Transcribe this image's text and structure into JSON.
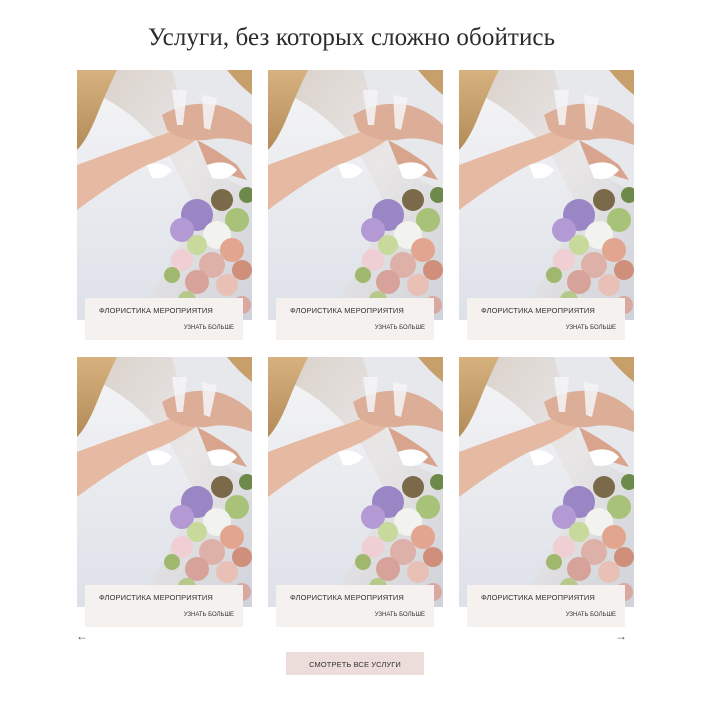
{
  "section": {
    "title": "Услуги, без которых сложно обойтись"
  },
  "cards": [
    {
      "title": "ФЛОРИСТИКА МЕРОПРИЯТИЯ",
      "more": "УЗНАТЬ БОЛЬШЕ"
    },
    {
      "title": "ФЛОРИСТИКА МЕРОПРИЯТИЯ",
      "more": "УЗНАТЬ БОЛЬШЕ"
    },
    {
      "title": "ФЛОРИСТИКА МЕРОПРИЯТИЯ",
      "more": "УЗНАТЬ БОЛЬШЕ"
    },
    {
      "title": "ФЛОРИСТИКА МЕРОПРИЯТИЯ",
      "more": "УЗНАТЬ БОЛЬШЕ"
    },
    {
      "title": "ФЛОРИСТИКА МЕРОПРИЯТИЯ",
      "more": "УЗНАТЬ БОЛЬШЕ"
    },
    {
      "title": "ФЛОРИСТИКА МЕРОПРИЯТИЯ",
      "more": "УЗНАТЬ БОЛЬШЕ"
    }
  ],
  "nav": {
    "prev": "←",
    "next": "→"
  },
  "cta": {
    "label": "СМОТРЕТЬ ВСЕ УСЛУГИ"
  },
  "colors": {
    "caption_bg": "#f4f1ee",
    "cta_bg": "#ecdcda"
  }
}
